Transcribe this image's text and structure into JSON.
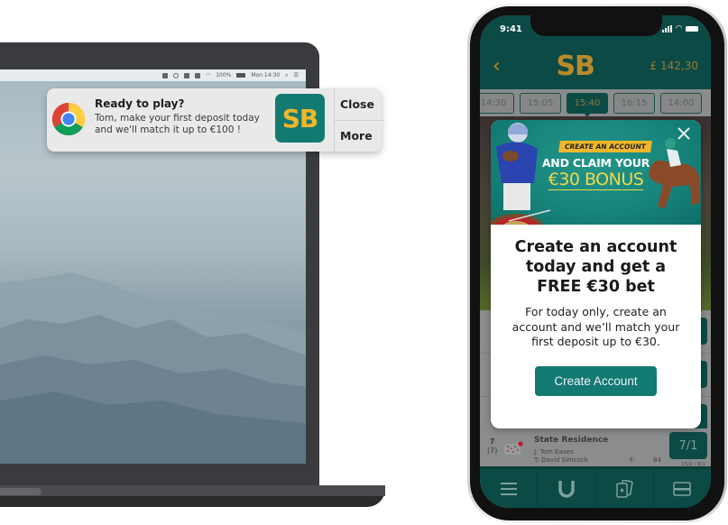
{
  "laptop": {
    "menubar": {
      "battery_percent": "100%",
      "clock": "Mon 14:30"
    }
  },
  "notification": {
    "app_icon": "chrome-icon",
    "title": "Ready to play?",
    "body": "Tom, make your first deposit today and we'll match it up to €100 !",
    "brand_logo_text": "SB",
    "actions": {
      "close_label": "Close",
      "more_label": "More"
    }
  },
  "phone": {
    "status_bar": {
      "time": "9:41"
    },
    "header": {
      "back_icon": "chevron-left-icon",
      "logo_text": "SB",
      "balance": "£ 142,30"
    },
    "race_tabs": [
      {
        "label": "14:30",
        "active": false
      },
      {
        "label": "15:05",
        "active": false
      },
      {
        "label": "15:40",
        "active": true
      },
      {
        "label": "16:15",
        "active": false
      },
      {
        "label": "14:00",
        "active": false
      }
    ],
    "modal": {
      "close_icon": "close-icon",
      "banner": {
        "pill_text": "CREATE AN ACCOUNT",
        "line1": "AND CLAIM YOUR",
        "line2": "€30 BONUS"
      },
      "heading": "Create an account today and get a FREE €30 bet",
      "description": "For today only, create an account and we’ll match your first deposit up to €30.",
      "cta_label": "Create Account"
    },
    "runner": {
      "number": "7",
      "draw": "(7)",
      "name": "State Residence",
      "jockey": "J: Tom Eaves",
      "trainer": "T: David Simcock",
      "form": "F:",
      "rating": "84",
      "odds": "7/1",
      "previous_odds": "15/2 › 8/1"
    },
    "tab_bar": [
      {
        "icon": "menu-icon",
        "label": "Menu"
      },
      {
        "icon": "horseshoe-icon",
        "label": "Racing"
      },
      {
        "icon": "cards-icon",
        "label": "Casino"
      },
      {
        "icon": "card-icon",
        "label": "Payments"
      }
    ],
    "colors": {
      "brand_teal": "#0c4a46",
      "cta_teal": "#137a72",
      "brand_gold": "#b88a2a",
      "bonus_yellow": "#f1d84a"
    }
  }
}
